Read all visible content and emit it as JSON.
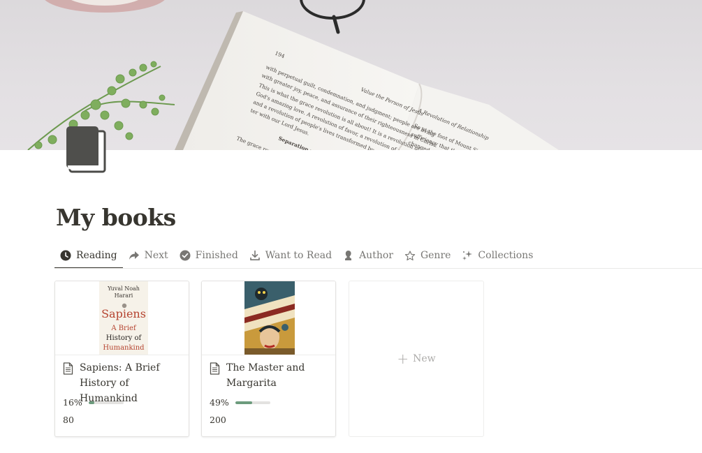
{
  "page": {
    "title": "My books",
    "cover": {
      "book_left_page": {
        "page_number": "194",
        "lines": [
          "with perpetual guilt, condemnation, and judgment; people are living",
          "with greater joy, peace, and assurance of their righteousness in Christ.",
          "This is what the grace revolution is all about! It is a revolution of",
          "God's amazing love. A revolution of favor, a revolution of grace,",
          "and a revolution of people's lives transformed by a powerful encoun-",
          "ter with our Lord Jesus."
        ],
        "heading": "Separation vs.",
        "running_head": "Value the Person of Jesus",
        "after_heading": "The grace revolu"
      },
      "book_right_page": {
        "running_head": "A Revolution of Relationship",
        "lines": [
          "So at the foot of Mount Si",
          "sufficiency that they said",
          "changed. The people said"
        ]
      }
    },
    "icon": "book-icon"
  },
  "tabs": [
    {
      "label": "Reading",
      "icon": "clock-icon",
      "active": true
    },
    {
      "label": "Next",
      "icon": "arrow-forward-icon",
      "active": false
    },
    {
      "label": "Finished",
      "icon": "check-circle-icon",
      "active": false
    },
    {
      "label": "Want to Read",
      "icon": "download-icon",
      "active": false
    },
    {
      "label": "Author",
      "icon": "person-icon",
      "active": false
    },
    {
      "label": "Genre",
      "icon": "star-icon",
      "active": false
    },
    {
      "label": "Collections",
      "icon": "sparkle-icon",
      "active": false
    }
  ],
  "cards": [
    {
      "title": "Sapiens: A Brief History of Humankind",
      "progress_label": "16%",
      "progress": 0.16,
      "pages": "80",
      "cover": {
        "author_line1": "Yuval Noah",
        "author_line2": "Harari",
        "title_line1": "Sapiens",
        "title_line2": "A Brief",
        "title_line3": "History of",
        "title_line4": "Humankind"
      }
    },
    {
      "title": "The Master and Margarita",
      "progress_label": "49%",
      "progress": 0.49,
      "pages": "200",
      "cover": {
        "type": "illustrated"
      }
    }
  ],
  "new_card": {
    "label": "New"
  },
  "colors": {
    "text": "#37352f",
    "muted": "#787774",
    "progress_fill": "#6c9b7d",
    "progress_track": "#e3e2e0"
  }
}
